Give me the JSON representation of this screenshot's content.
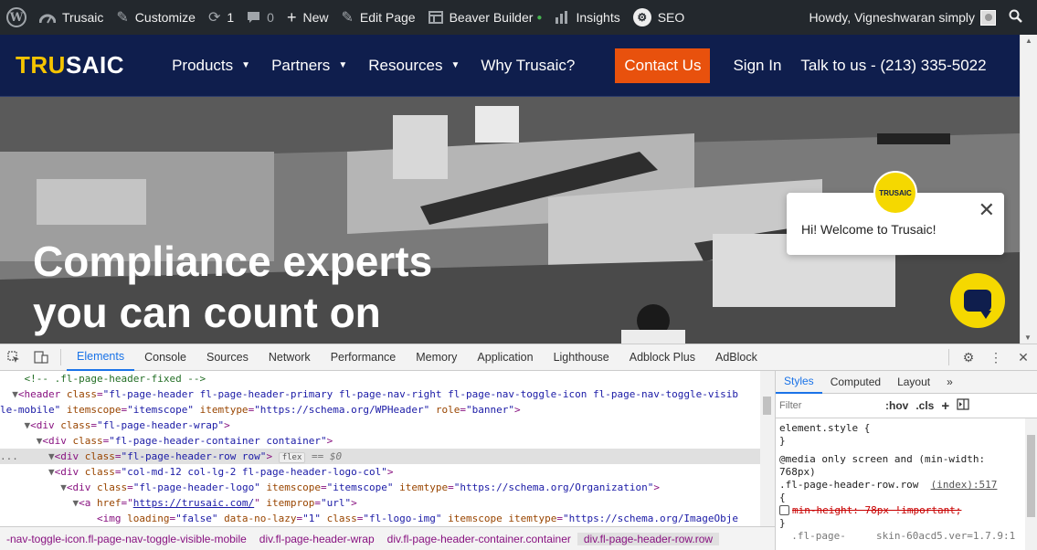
{
  "admin_bar": {
    "site_name": "Trusaic",
    "customize": "Customize",
    "updates_count": "1",
    "comments_count": "0",
    "new": "New",
    "edit_page": "Edit Page",
    "beaver_builder": "Beaver Builder",
    "insights": "Insights",
    "seo": "SEO",
    "howdy": "Howdy, Vigneshwaran simply"
  },
  "site_header": {
    "logo_part1": "TRU",
    "logo_part2": "SAIC",
    "nav": [
      {
        "label": "Products"
      },
      {
        "label": "Partners"
      },
      {
        "label": "Resources"
      },
      {
        "label": "Why Trusaic?"
      }
    ],
    "contact_button": "Contact Us",
    "sign_in": "Sign In",
    "talk": "Talk to us - (213) 335-5022"
  },
  "hero": {
    "title_line1": "Compliance experts",
    "title_line2": "you can count on"
  },
  "chat": {
    "avatar_text": "TRUSAIC",
    "message": "Hi! Welcome to Trusaic!",
    "close": "✕"
  },
  "devtools": {
    "tabs": [
      "Elements",
      "Console",
      "Sources",
      "Network",
      "Performance",
      "Memory",
      "Application",
      "Lighthouse",
      "Adblock Plus",
      "AdBlock"
    ],
    "active_tab": "Elements",
    "dom": {
      "l0_comment": "<!-- .fl-page-header-fixed -->",
      "l1_tag": "<header",
      "l1_a1": "class",
      "l1_v1": "\"fl-page-header fl-page-header-primary fl-page-nav-right fl-page-nav-toggle-icon fl-page-nav-toggle-visib",
      "l2_v1": "le-mobile\"",
      "l2_a2": "itemscope",
      "l2_v2": "\"itemscope\"",
      "l2_a3": "itemtype",
      "l2_v3": "\"https://schema.org/WPHeader\"",
      "l2_a4": "role",
      "l2_v4": "\"banner\"",
      "l3_v": "\"fl-page-header-wrap\"",
      "l4_v": "\"fl-page-header-container container\"",
      "l5_v": "\"fl-page-header-row row\"",
      "l5_pill": "flex",
      "l5_dollar": "== $0",
      "l6_v": "\"col-md-12 col-lg-2 fl-page-header-logo-col\"",
      "l7_v1": "\"fl-page-header-logo\"",
      "l7_v2": "\"itemscope\"",
      "l7_v3": "\"https://schema.org/Organization\"",
      "l8_href": "https://trusaic.com/",
      "l8_v2": "\"url\"",
      "l9_v1": "\"false\"",
      "l9_v2": "\"1\"",
      "l9_v3": "\"fl-logo-img\"",
      "l9_v4": "\"https://schema.org/ImageObje"
    },
    "breadcrumbs": [
      "-nav-toggle-icon.fl-page-nav-toggle-visible-mobile",
      "div.fl-page-header-wrap",
      "div.fl-page-header-container.container",
      "div.fl-page-header-row.row"
    ],
    "styles_tabs": [
      "Styles",
      "Computed",
      "Layout"
    ],
    "filter_placeholder": "Filter",
    "hov": ":hov",
    "cls": ".cls",
    "element_style": "element.style {",
    "close_brace": "}",
    "media_rule": "@media only screen and (min-width:",
    "media_rule2": "768px)",
    "selector": ".fl-page-header-row.row",
    "source": "(index):517",
    "open_brace": "{",
    "struck_decl": "min-height: 78px !important;",
    "bottom_line": "  .fl-page-     skin-60acd5.ver=1.7.9:1"
  }
}
